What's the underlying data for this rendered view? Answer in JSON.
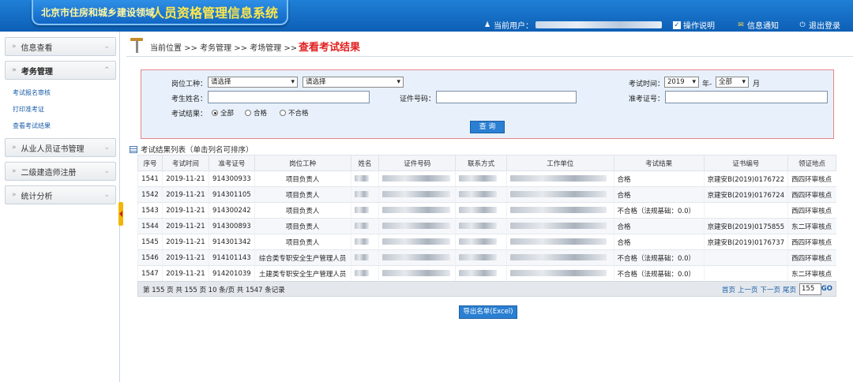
{
  "header": {
    "subtitle": "北京市住房和城乡建设领域",
    "title": "人员资格管理信息系统",
    "current_user_label": "当前用户：",
    "help": "操作说明",
    "notice": "信息通知",
    "logout": "退出登录"
  },
  "sidebar": {
    "menus": [
      {
        "label": "信息查看"
      },
      {
        "label": "考务管理"
      },
      {
        "label": "从业人员证书管理"
      },
      {
        "label": "二级建造师注册"
      },
      {
        "label": "统计分析"
      }
    ],
    "subitems": [
      {
        "label": "考试报名审核"
      },
      {
        "label": "打印准考证"
      },
      {
        "label": "查看考试结果"
      }
    ]
  },
  "breadcrumb": {
    "path": "当前位置 >> 考务管理 >> 考场管理 >>",
    "title": "查看考试结果"
  },
  "search": {
    "job_label": "岗位工种：",
    "job_select1": "请选择",
    "job_select2": "请选择",
    "exam_time_label": "考试时间：",
    "year_value": "2019",
    "year_label": "年-",
    "month_value": "全部",
    "month_label": "月",
    "name_label": "考生姓名：",
    "id_label": "证件号码：",
    "ticket_label": "准考证号：",
    "result_label": "考试结果：",
    "radio_all": "全部",
    "radio_pass": "合格",
    "radio_fail": "不合格",
    "query_button": "查 询"
  },
  "results": {
    "title": "考试结果列表（单击列名可排序）",
    "columns": [
      "序号",
      "考试时间",
      "准考证号",
      "岗位工种",
      "姓名",
      "证件号码",
      "联系方式",
      "工作单位",
      "考试结果",
      "证书编号",
      "领证地点"
    ],
    "rows": [
      {
        "no": "1541",
        "date": "2019-11-21",
        "ticket": "914300933",
        "job": "项目负责人",
        "result": "合格",
        "cert": "京建安B(2019)0176722",
        "place": "西四环审核点"
      },
      {
        "no": "1542",
        "date": "2019-11-21",
        "ticket": "914301105",
        "job": "项目负责人",
        "result": "合格",
        "cert": "京建安B(2019)0176724",
        "place": "西四环审核点"
      },
      {
        "no": "1543",
        "date": "2019-11-21",
        "ticket": "914300242",
        "job": "项目负责人",
        "result": "不合格（法规基础：0.0）",
        "cert": "",
        "place": "西四环审核点"
      },
      {
        "no": "1544",
        "date": "2019-11-21",
        "ticket": "914300893",
        "job": "项目负责人",
        "result": "合格",
        "cert": "京建安B(2019)0175855",
        "place": "东二环审核点"
      },
      {
        "no": "1545",
        "date": "2019-11-21",
        "ticket": "914301342",
        "job": "项目负责人",
        "result": "合格",
        "cert": "京建安B(2019)0176737",
        "place": "西四环审核点"
      },
      {
        "no": "1546",
        "date": "2019-11-21",
        "ticket": "914101143",
        "job": "综合类专职安全生产管理人员",
        "result": "不合格（法规基础：0.0）",
        "cert": "",
        "place": "西四环审核点"
      },
      {
        "no": "1547",
        "date": "2019-11-21",
        "ticket": "914201039",
        "job": "土建类专职安全生产管理人员",
        "result": "不合格（法规基础：0.0）",
        "cert": "",
        "place": "东二环审核点"
      }
    ]
  },
  "pager": {
    "info": "第 155 页  共 155 页   10 条/页   共 1547 条记录",
    "first": "首页",
    "prev": "上一页",
    "next": "下一页",
    "last": "尾页",
    "page_value": "155",
    "go": "GO"
  },
  "export_button": "导出名单(Excel)"
}
